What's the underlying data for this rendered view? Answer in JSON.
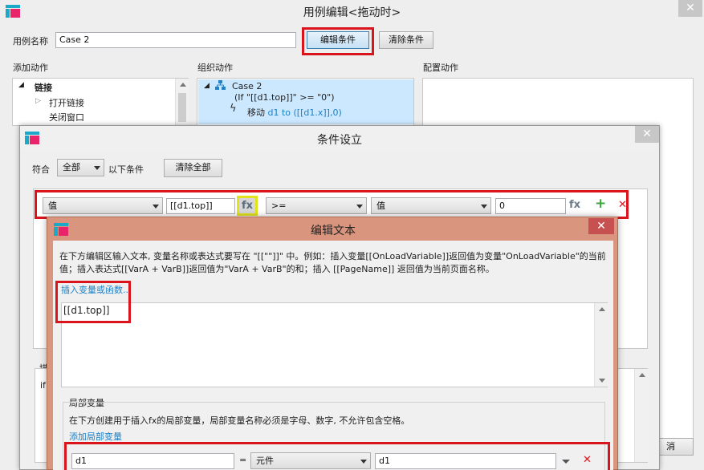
{
  "main_window": {
    "title": "用例编辑<拖动时>",
    "case_name_label": "用例名称",
    "case_name_value": "Case 2",
    "edit_condition_button": "编辑条件",
    "clear_condition_button": "清除条件",
    "add_actions_label": "添加动作",
    "organize_actions_label": "组织动作",
    "configure_actions_label": "配置动作",
    "add_actions_tree": {
      "group": "链接",
      "items": [
        "打开链接",
        "关闭窗口"
      ]
    },
    "organize_tree": {
      "case": "Case 2",
      "condition": "(If \"[[d1.top]]\" >= \"0\")",
      "action_verb": "移动",
      "action_detail": "d1 to ([[d1.x]],0)"
    },
    "cancel_button_partial": "消"
  },
  "condition_dialog": {
    "title": "条件设立",
    "match_label": "符合",
    "match_value": "全部",
    "following_conditions_label": "以下条件",
    "clear_all_button": "清除全部",
    "row": {
      "left_type": "值",
      "left_value": "[[d1.top]]",
      "fx_label": "fx",
      "operator": ">=",
      "right_type": "值",
      "right_value": "0",
      "fx2_label": "fx",
      "add_symbol": "+",
      "delete_symbol": "✕"
    },
    "bottom_label_partial": "描",
    "bottom_text_partial": "if"
  },
  "edit_text_dialog": {
    "title": "编辑文本",
    "description": "在下方编辑区输入文本, 变量名称或表达式要写在 \"[[\"\"]]\" 中。例如：插入变量[[OnLoadVariable]]返回值为变量\"OnLoadVariable\"的当前值；插入表达式[[VarA + VarB]]返回值为\"VarA + VarB\"的和；插入 [[PageName]] 返回值为当前页面名称。",
    "insert_variable_link": "插入变量或函数...",
    "editor_value": "[[d1.top]]",
    "local_vars_section": "局部变量",
    "local_vars_description": "在下方创建用于插入fx的局部变量，局部变量名称必须是字母、数字, 不允许包含空格。",
    "add_local_var_link": "添加局部变量",
    "local_var_row": {
      "name": "d1",
      "equals": "=",
      "type": "元件",
      "target": "d1",
      "delete_symbol": "✕"
    }
  },
  "colors": {
    "highlight_red": "#d9141c",
    "fx_highlight_yellow": "#e3e31b",
    "edit_dialog_bg": "#d9957e",
    "link_blue": "#1b7fc4",
    "selection_blue": "#cce8ff",
    "add_green": "#3aa53a"
  }
}
